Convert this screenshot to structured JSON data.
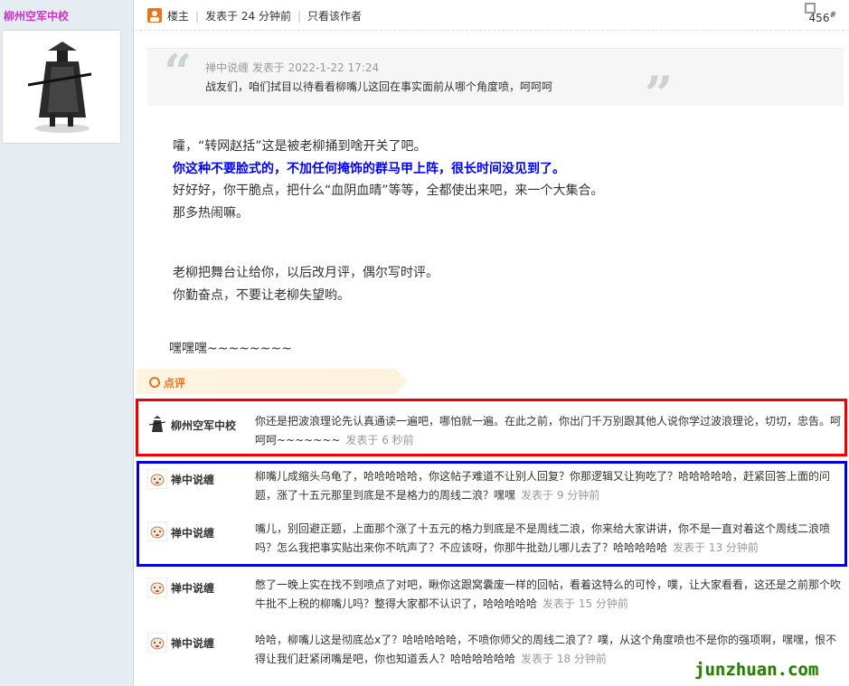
{
  "author": {
    "name": "柳州空军中校"
  },
  "post_header": {
    "role": "楼主",
    "posted": "发表于 24 分钟前",
    "author_only": "只看该作者",
    "floor": "456",
    "floor_sup": "#"
  },
  "quote": {
    "head": "禅中说缠 发表于 2022-1-22 17:24",
    "body": "战友们，咱们拭目以待看看柳嘴儿这回在事实面前从哪个角度喷，呵呵呵"
  },
  "content": {
    "line1": "嚯，“转网赵括”这是被老柳捅到啥开关了吧。",
    "line2": "你这种不要脸式的，不加任何掩饰的群马甲上阵，很长时间没见到了。",
    "line3": "好好好，你干脆点，把什么“血阴血晴”等等，全都使出来吧，来一个大集合。",
    "line4": "那多热闹嘛。",
    "line5": "老柳把舞台让给你，以后改月评，偶尔写时评。",
    "line6": "你勤奋点，不要让老柳失望哟。",
    "line7": "嘿嘿嘿~~~~~~~~"
  },
  "dianping": {
    "label": "点评"
  },
  "comments": [
    {
      "name": "柳州空军中校",
      "text": "你还是把波浪理论先认真通读一遍吧，哪怕就一遍。在此之前，你出门千万别跟其他人说你学过波浪理论，切切，忠告。呵呵呵~~~~~~~",
      "time": "发表于 6 秒前"
    },
    {
      "name": "禅中说缠",
      "text": "柳嘴儿成缩头乌龟了，哈哈哈哈哈，你这帖子难道不让别人回复？你那逻辑又让狗吃了？哈哈哈哈哈，赶紧回答上面的问题，涨了十五元那里到底是不是格力的周线二浪？嘿嘿",
      "time": "发表于 9 分钟前"
    },
    {
      "name": "禅中说缠",
      "text": "嘴儿，别回避正题，上面那个涨了十五元的格力到底是不是周线二浪，你来给大家讲讲，你不是一直对着这个周线二浪喷吗？怎么我把事实贴出来你不吭声了？不应该呀，你那牛批劲儿哪儿去了？哈哈哈哈哈",
      "time": "发表于 13 分钟前"
    },
    {
      "name": "禅中说缠",
      "text": "憋了一晚上实在找不到喷点了对吧，瞅你这跟窝囊废一样的回帖，看着这特么的可怜，噗，让大家看看，这还是之前那个吹牛批不上税的柳嘴儿吗？整得大家都不认识了，哈哈哈哈哈",
      "time": "发表于 15 分钟前"
    },
    {
      "name": "禅中说缠",
      "text": "哈哈，柳嘴儿这是彻底怂x了？哈哈哈哈哈，不喷你师父的周线二浪了？噗，从这个角度喷也不是你的强项啊，嘿嘿，恨不得让我们赶紧闭嘴是吧，你也知道丢人？哈哈哈哈哈哈",
      "time": "发表于 18 分钟前"
    }
  ],
  "watermark": "junzhuan.com",
  "colors": {
    "sidebar_bg": "#e5edf2",
    "author_name": "#cc33cc",
    "highlight_blue": "#0000ff",
    "accent_orange": "#e8741d",
    "red_box": "#ee0000",
    "blue_box": "#0000dd",
    "watermark": "#2b7a0b"
  }
}
